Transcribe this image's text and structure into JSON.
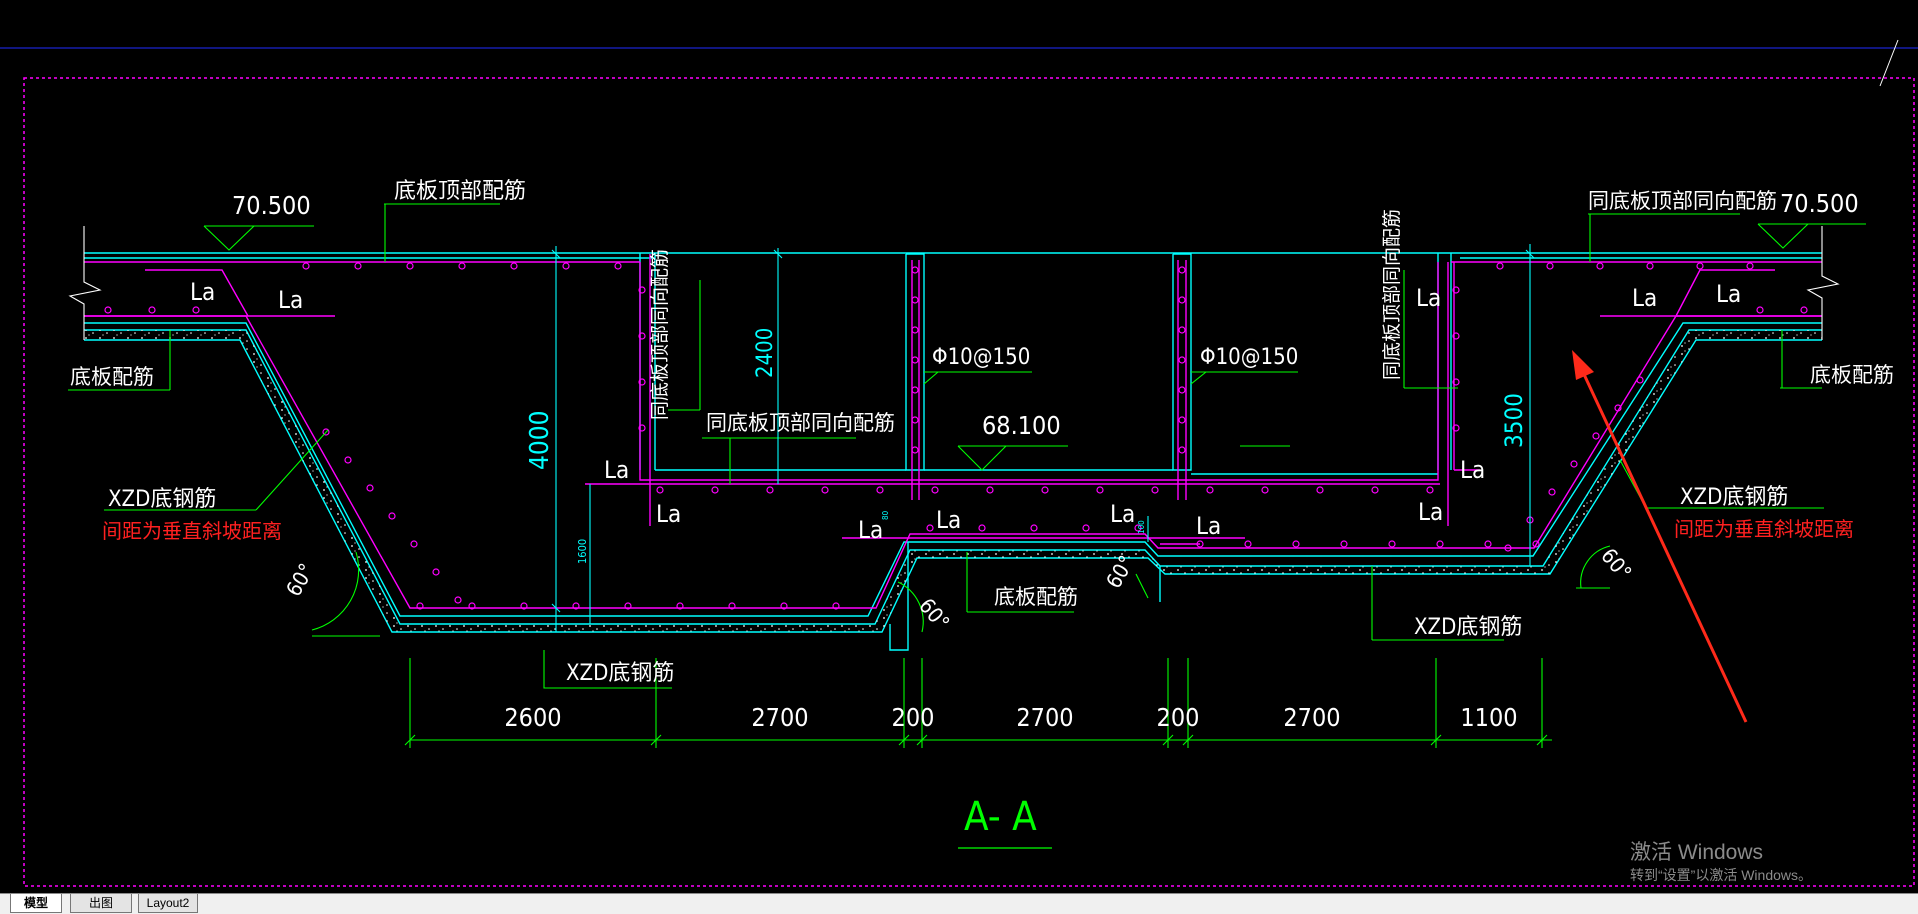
{
  "drawing": {
    "section_title": "A- A",
    "elevations": {
      "left_top": "70.500",
      "right_top": "70.500",
      "center_bottom": "68.100"
    },
    "notes": {
      "slab_top_rebar": "底板顶部配筋",
      "same_as_slab_top_right": "同底板顶部同向配筋",
      "same_as_slab_top_center": "同底板顶部同向配筋",
      "same_as_slab_top_vertical_left": "同底板顶部同向配筋",
      "same_as_slab_top_vertical_right": "同底板顶部同向配筋",
      "slab_rebar_left": "底板配筋",
      "slab_rebar_right": "底板配筋",
      "slab_rebar_center": "底板配筋",
      "xzd_left": "XZD底钢筋",
      "xzd_left_note": "间距为垂直斜坡距离",
      "xzd_right": "XZD底钢筋",
      "xzd_right_note": "间距为垂直斜坡距离",
      "xzd_bottom_left": "XZD底钢筋",
      "xzd_bottom_right": "XZD底钢筋",
      "rebar_spec_1": "Φ10@150",
      "rebar_spec_2": "Φ10@150"
    },
    "anchorage_label": "La",
    "angle_label": "60°",
    "dimensions": {
      "depth_left": "4000",
      "depth_right": "3500",
      "wall_2400": "2400",
      "small_1600": "1600",
      "tiny_1": "80",
      "tiny_2": "100"
    },
    "bottom_dims": [
      "2600",
      "2700",
      "200",
      "2700",
      "200",
      "2700",
      "1100"
    ],
    "colors": {
      "background": "#000000",
      "concrete_outline": "#00ffff",
      "rebar": "#ff00ff",
      "leader": "#00ff00",
      "text": "#ffffff",
      "note_red": "#ff2020",
      "annotation_arrow": "#ff2a1a",
      "border": "#ff00ff",
      "axis": "#0000ff"
    }
  },
  "tabs": [
    {
      "label": "模型",
      "active": true
    },
    {
      "label": "出图",
      "active": false
    },
    {
      "label": "Layout2",
      "active": false
    }
  ],
  "watermark": {
    "line1": "激活 Windows",
    "line2": "转到“设置”以激活 Windows。"
  }
}
